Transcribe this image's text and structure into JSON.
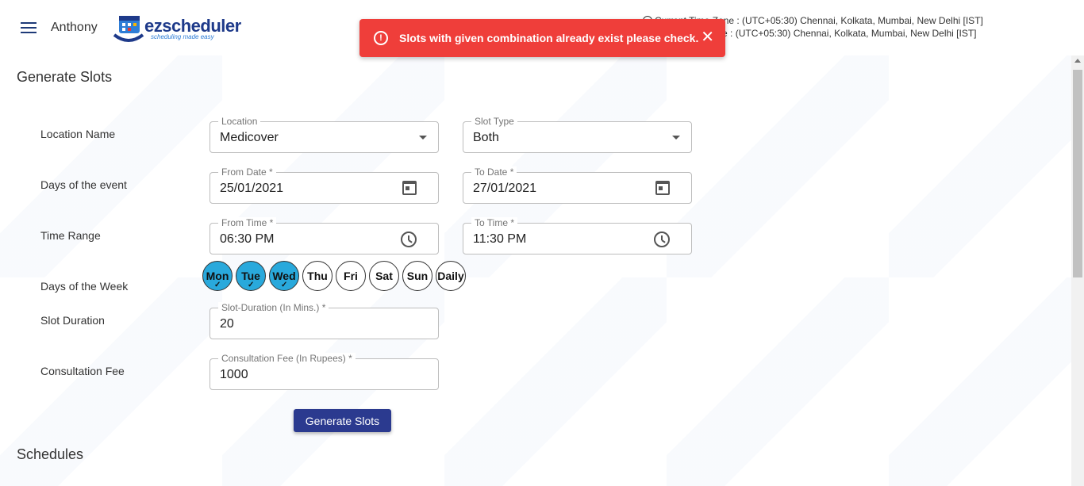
{
  "header": {
    "user_name": "Anthony",
    "logo_text": "ezscheduler",
    "logo_tagline": "scheduling made easy",
    "timezone_line1": "Current Time Zone : (UTC+05:30) Chennai, Kolkata, Mumbai, New Delhi [IST]",
    "timezone_line2": "Selected Time Zone : (UTC+05:30) Chennai, Kolkata, Mumbai, New Delhi [IST]"
  },
  "toast": {
    "message": "Slots with given combination already exist please check.",
    "icon": "error-icon",
    "close": "✕",
    "color": "#ef3e3a"
  },
  "generate_slots": {
    "title": "Generate Slots",
    "labels": {
      "location_name": "Location Name",
      "days_of_event": "Days of the event",
      "time_range": "Time Range",
      "days_of_week": "Days of the Week",
      "slot_duration": "Slot Duration",
      "consultation_fee": "Consultation Fee"
    },
    "location": {
      "legend": "Location",
      "value": "Medicover"
    },
    "slot_type": {
      "legend": "Slot Type",
      "value": "Both"
    },
    "from_date": {
      "legend": "From Date *",
      "value": "25/01/2021"
    },
    "to_date": {
      "legend": "To Date *",
      "value": "27/01/2021"
    },
    "from_time": {
      "legend": "From Time *",
      "value": "06:30 PM"
    },
    "to_time": {
      "legend": "To Time *",
      "value": "11:30 PM"
    },
    "days": [
      {
        "label": "Mon",
        "selected": true
      },
      {
        "label": "Tue",
        "selected": true
      },
      {
        "label": "Wed",
        "selected": true
      },
      {
        "label": "Thu",
        "selected": false
      },
      {
        "label": "Fri",
        "selected": false
      },
      {
        "label": "Sat",
        "selected": false
      },
      {
        "label": "Sun",
        "selected": false
      },
      {
        "label": "Daily",
        "selected": false
      }
    ],
    "slot_duration": {
      "legend": "Slot-Duration (In Mins.) *",
      "value": "20"
    },
    "consultation_fee": {
      "legend": "Consultation Fee (In Rupees) *",
      "value": "1000"
    },
    "button_label": "Generate Slots",
    "accent_color": "#29a9dc",
    "button_color": "#2b3a8f"
  },
  "schedules": {
    "title": "Schedules"
  }
}
